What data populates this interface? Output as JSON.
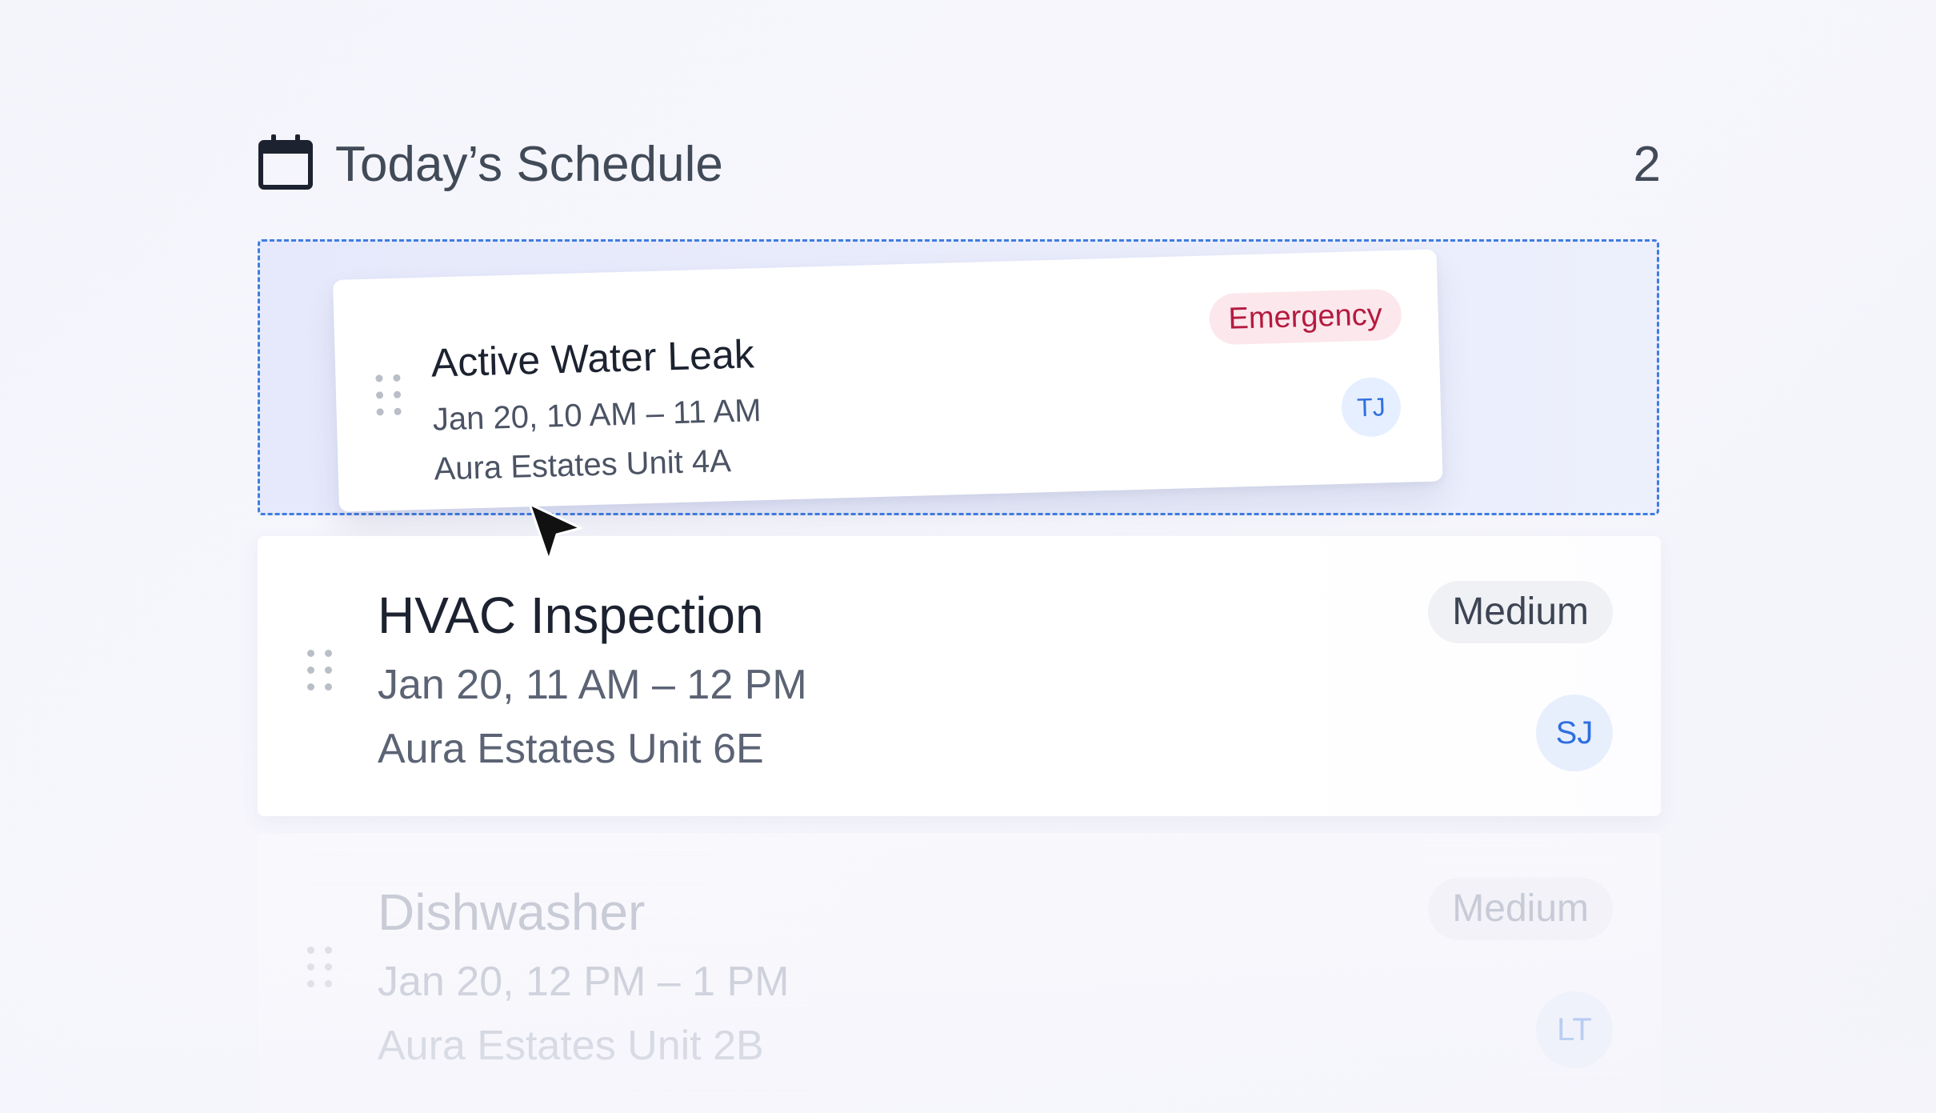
{
  "header": {
    "icon": "calendar-icon",
    "title": "Today’s Schedule",
    "count": "2"
  },
  "dragging_card": {
    "title": "Active Water Leak",
    "time": "Jan 20, 10 AM – 11 AM",
    "location": "Aura Estates Unit 4A",
    "priority": "Emergency",
    "assignee": "TJ",
    "priority_color": "#b51a3f",
    "priority_bg": "#fbe7ec"
  },
  "cards": [
    {
      "title": "HVAC Inspection",
      "time": "Jan 20, 11 AM – 12 PM",
      "location": "Aura Estates Unit 6E",
      "priority": "Medium",
      "assignee": "SJ"
    },
    {
      "title": "Dishwasher",
      "time": "Jan 20, 12 PM – 1 PM",
      "location": "Aura Estates Unit 2B",
      "priority": "Medium",
      "assignee": "LT"
    }
  ],
  "colors": {
    "dropzone_border": "#3f7de0",
    "avatar_text": "#2f6fe0"
  }
}
